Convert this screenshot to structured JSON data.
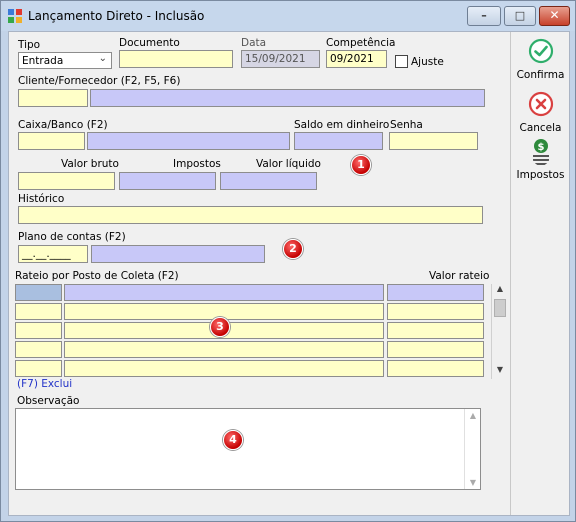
{
  "window": {
    "title": "Lançamento Direto - Inclusão",
    "controls": {
      "minimize": "–",
      "maximize": "□",
      "close": "✕"
    }
  },
  "form": {
    "tipo": {
      "label": "Tipo",
      "value": "Entrada"
    },
    "documento": {
      "label": "Documento",
      "value": ""
    },
    "data": {
      "label": "Data",
      "value": "15/09/2021"
    },
    "competencia": {
      "label": "Competência",
      "value": "09/2021"
    },
    "ajuste": {
      "label": "Ajuste",
      "checked": false
    },
    "cliente": {
      "label": "Cliente/Fornecedor (F2, F5, F6)",
      "code": "",
      "name": ""
    },
    "caixa": {
      "label": "Caixa/Banco (F2)",
      "code": "",
      "name": ""
    },
    "saldo": {
      "label": "Saldo em dinheiro",
      "value": ""
    },
    "senha": {
      "label": "Senha",
      "value": ""
    },
    "valor_bruto": {
      "label": "Valor bruto",
      "value": ""
    },
    "impostos": {
      "label": "Impostos",
      "value": ""
    },
    "valor_liquido": {
      "label": "Valor líquido",
      "value": ""
    },
    "historico": {
      "label": "Histórico",
      "value": ""
    },
    "plano": {
      "label": "Plano de contas (F2)",
      "code": "__.__.____",
      "name": ""
    },
    "rateio": {
      "label": "Rateio por Posto de Coleta (F2)",
      "valor_label": "Valor rateio",
      "rows": 5
    },
    "exclui_hint": "(F7) Exclui",
    "observacao": {
      "label": "Observação",
      "value": ""
    }
  },
  "markers": [
    "1",
    "2",
    "3",
    "4"
  ],
  "sidebar": {
    "confirma": {
      "label": "Confirma",
      "icon": "check-circle-icon",
      "color": "#2fae6b"
    },
    "cancela": {
      "label": "Cancela",
      "icon": "x-circle-icon",
      "color": "#d94040"
    },
    "impostos": {
      "label": "Impostos",
      "icon": "money-stack-icon",
      "color": "#2e8a3c"
    }
  },
  "colors": {
    "field_yellow": "#ffffc8",
    "field_lavender": "#c8c8f8",
    "hint_blue": "#2232c8",
    "marker_red": "#c40000"
  }
}
